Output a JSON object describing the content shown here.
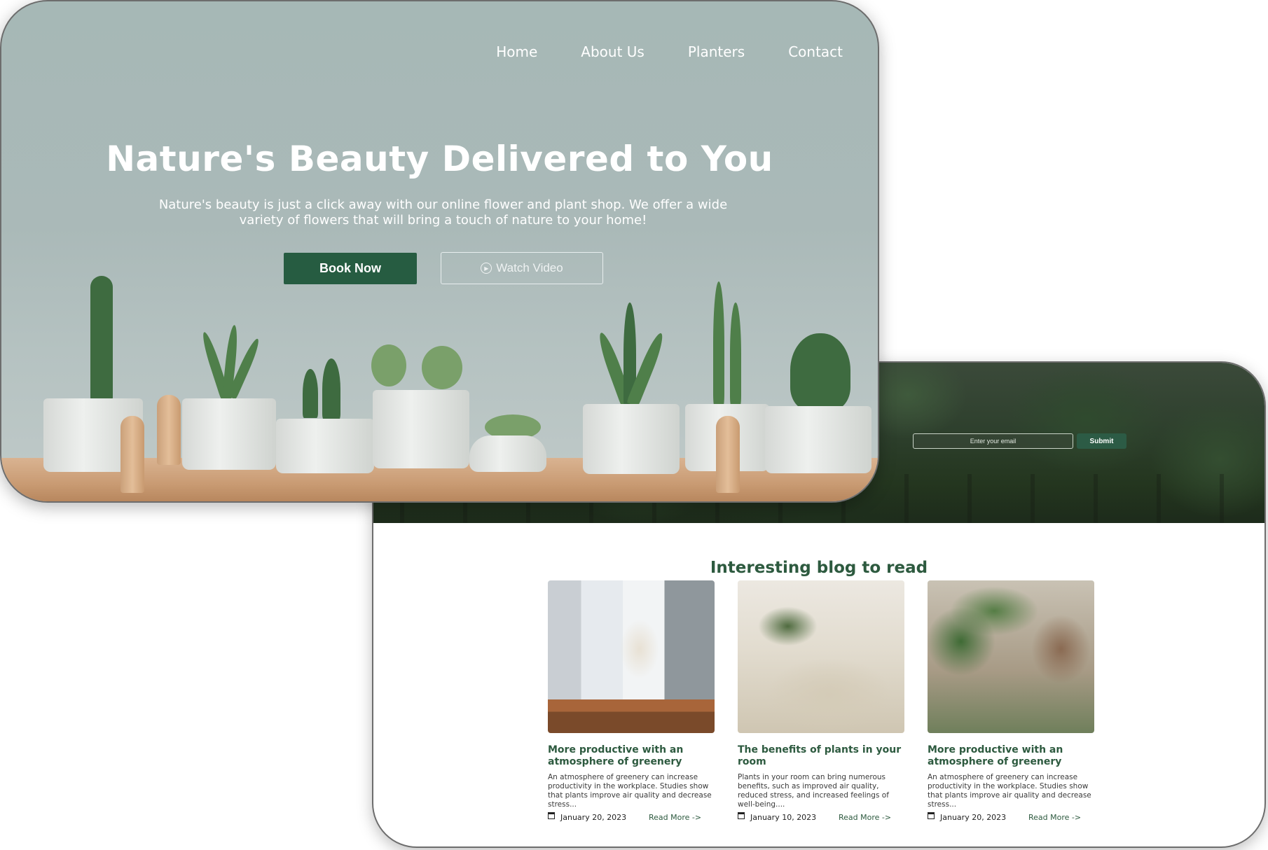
{
  "hero": {
    "nav": [
      "Home",
      "About Us",
      "Planters",
      "Contact"
    ],
    "title": "Nature's Beauty Delivered to You",
    "subtitle": "Nature's beauty is just a click away with our online flower and plant shop. We offer a wide variety of flowers that will bring a touch of nature to your home!",
    "book_label": "Book Now",
    "watch_label": "Watch Video"
  },
  "newsletter": {
    "placeholder": "Enter your email",
    "submit_label": "Submit"
  },
  "blog": {
    "title": "Interesting blog to read",
    "read_more": "Read More ->",
    "posts": [
      {
        "title": "More productive with an atmosphere of greenery",
        "excerpt": "An atmosphere of greenery can increase productivity in the workplace. Studies show that plants improve air quality and decrease stress...",
        "date": "January 20, 2023"
      },
      {
        "title": "The benefits of plants in your room",
        "excerpt": "Plants in your room can bring numerous benefits, such as improved air quality, reduced stress, and increased feelings of well-being....",
        "date": "January 10, 2023"
      },
      {
        "title": "More productive with an atmosphere of greenery",
        "excerpt": "An atmosphere of greenery can increase productivity in the workplace. Studies show that plants improve air quality and decrease stress...",
        "date": "January 20, 2023"
      }
    ]
  },
  "colors": {
    "brand_green": "#265c41",
    "heading_green": "#2d5a3f",
    "hero_bg": "#a6b8b6"
  },
  "icons": [
    "play-icon",
    "calendar-icon"
  ]
}
